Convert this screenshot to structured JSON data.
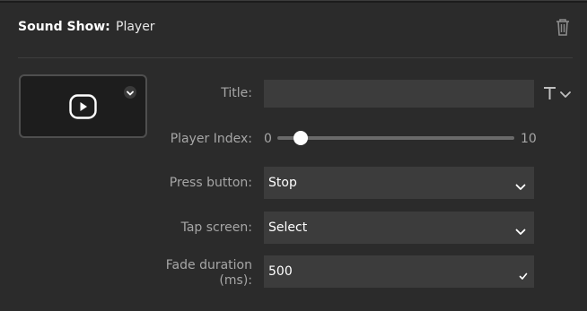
{
  "header": {
    "title": "Sound Show:",
    "value": "Player",
    "delete_icon": "trash-icon"
  },
  "preview": {
    "icon": "play-circle-icon",
    "menu_icon": "chevron-down-icon"
  },
  "form": {
    "title": {
      "label": "Title:",
      "value": "",
      "format_icon": "text-format-icon"
    },
    "player_index": {
      "label": "Player Index:",
      "min": "0",
      "max": "10",
      "value": 1
    },
    "press_button": {
      "label": "Press button:",
      "value": "Stop"
    },
    "tap_screen": {
      "label": "Tap screen:",
      "value": "Select"
    },
    "fade_duration": {
      "label_line1": "Fade duration",
      "label_line2": "(ms):",
      "value": "500"
    }
  },
  "colors": {
    "panel_bg": "#2b2b2b",
    "field_bg": "#3c3c3c",
    "label": "#a6a6a6",
    "text": "#ffffff"
  }
}
